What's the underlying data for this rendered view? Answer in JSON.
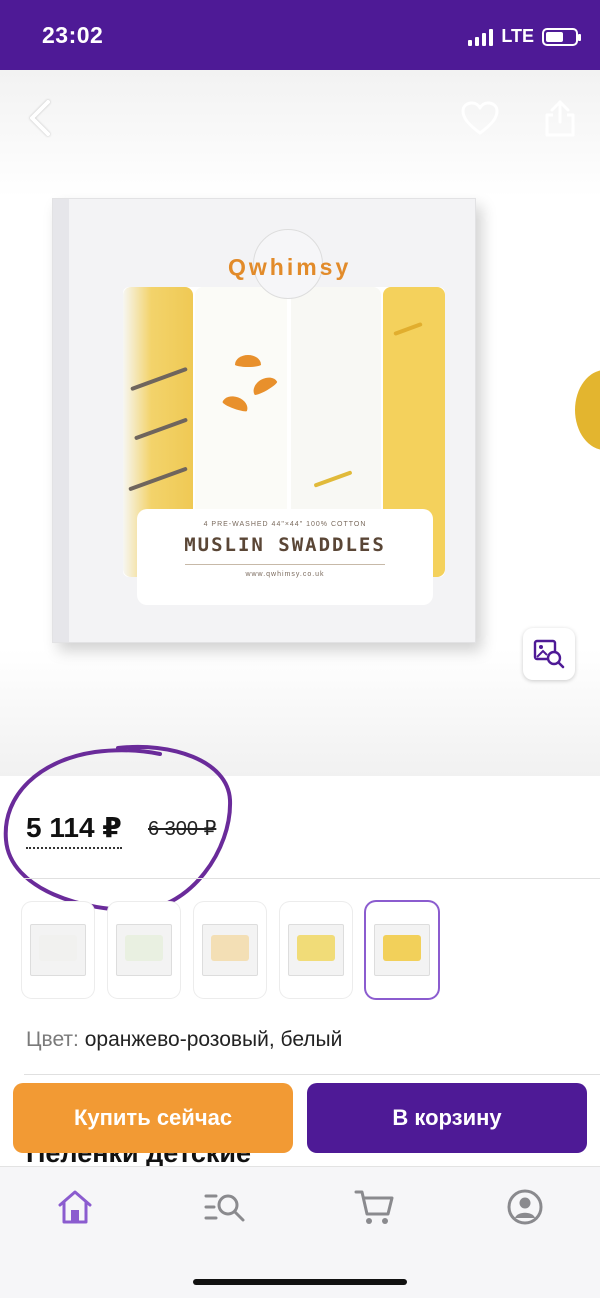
{
  "status_bar": {
    "time": "23:02",
    "network": "LTE"
  },
  "hero": {
    "box_brand": "Qwhimsy",
    "box_subtitle": "4 PRE-WASHED 44\"×44\" 100% COTTON",
    "box_title": "MUSLIN SWADDLES",
    "box_website": "www.qwhimsy.co.uk",
    "icons": {
      "back": "back-arrow-icon",
      "favorite": "heart-icon",
      "share": "share-icon",
      "zoom": "image-search-icon"
    }
  },
  "price": {
    "current": "5 114 ₽",
    "old": "6 300 ₽"
  },
  "thumbnails": [
    {
      "label": "variant-1",
      "color": "#f1f1ef",
      "selected": false
    },
    {
      "label": "variant-2",
      "color": "#e9f0e1",
      "selected": false
    },
    {
      "label": "variant-3",
      "color": "#f3dfb5",
      "selected": false
    },
    {
      "label": "variant-4",
      "color": "#f1dc78",
      "selected": false
    },
    {
      "label": "variant-5",
      "color": "#f2d05a",
      "selected": true
    }
  ],
  "color": {
    "label": "Цвет:",
    "value": "оранжево-розовый, белый"
  },
  "title_peek": "Пеленки детские",
  "actions": {
    "buy_now": "Купить сейчас",
    "add_to_cart": "В корзину"
  },
  "tab_bar": {
    "icons": [
      "home-icon",
      "catalog-search-icon",
      "cart-icon",
      "profile-icon"
    ]
  },
  "colors": {
    "brand_purple": "#4e1a96",
    "orange": "#f29a34",
    "accent_active": "#8b5ccf",
    "annotation_circle": "#6a2b9a"
  }
}
